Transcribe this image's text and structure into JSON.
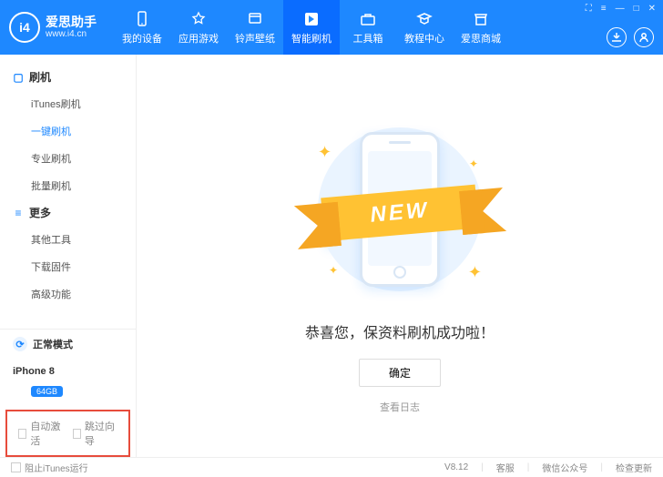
{
  "brand": {
    "name": "爱思助手",
    "url": "www.i4.cn",
    "logo": "i4"
  },
  "winControls": [
    "⛶",
    "≡",
    "—",
    "□",
    "✕"
  ],
  "tabs": [
    {
      "label": "我的设备",
      "icon": "device"
    },
    {
      "label": "应用游戏",
      "icon": "apps"
    },
    {
      "label": "铃声壁纸",
      "icon": "ring"
    },
    {
      "label": "智能刷机",
      "icon": "flash",
      "active": true
    },
    {
      "label": "工具箱",
      "icon": "tools"
    },
    {
      "label": "教程中心",
      "icon": "tutorial"
    },
    {
      "label": "爱思商城",
      "icon": "shop"
    }
  ],
  "sidebar": {
    "groups": [
      {
        "title": "刷机",
        "items": [
          "iTunes刷机",
          "一键刷机",
          "专业刷机",
          "批量刷机"
        ],
        "active": 1
      },
      {
        "title": "更多",
        "items": [
          "其他工具",
          "下载固件",
          "高级功能"
        ]
      }
    ],
    "mode": "正常模式",
    "device": {
      "name": "iPhone 8",
      "storage": "64GB"
    },
    "checks": [
      "自动激活",
      "跳过向导"
    ]
  },
  "main": {
    "ribbon": "NEW",
    "message": "恭喜您，保资料刷机成功啦！",
    "ok": "确定",
    "log": "查看日志"
  },
  "footer": {
    "block": "阻止iTunes运行",
    "version": "V8.12",
    "links": [
      "客服",
      "微信公众号",
      "检查更新"
    ]
  }
}
